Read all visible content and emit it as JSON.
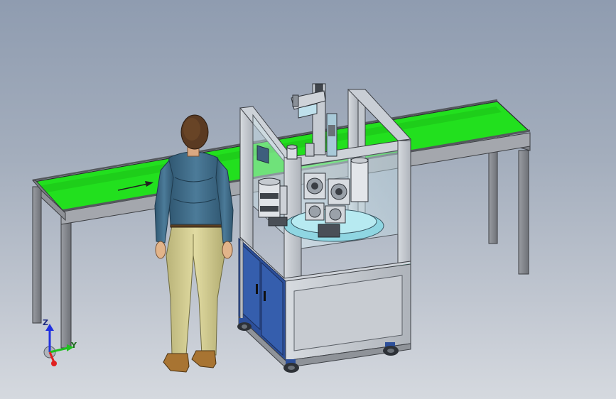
{
  "viewport": {
    "background_top": "#8f9cb0",
    "background_bottom": "#d5d9df"
  },
  "conveyor": {
    "belt_color": "#22e01e",
    "frame_color": "#8d9096",
    "flow_arrow": "arrow-right-icon"
  },
  "machine": {
    "frame_color": "#b9bec6",
    "cabinet_door_color": "#2c4f9a",
    "glass_color": "#cfe6ee"
  },
  "operator": {
    "jacket_color": "#3d6a86",
    "pants_color": "#d3cd90"
  },
  "triad": {
    "x_label": "",
    "y_label": "Y",
    "z_label": "Z",
    "x_color": "#e02020",
    "y_color": "#20c020",
    "z_color": "#2030e0"
  }
}
